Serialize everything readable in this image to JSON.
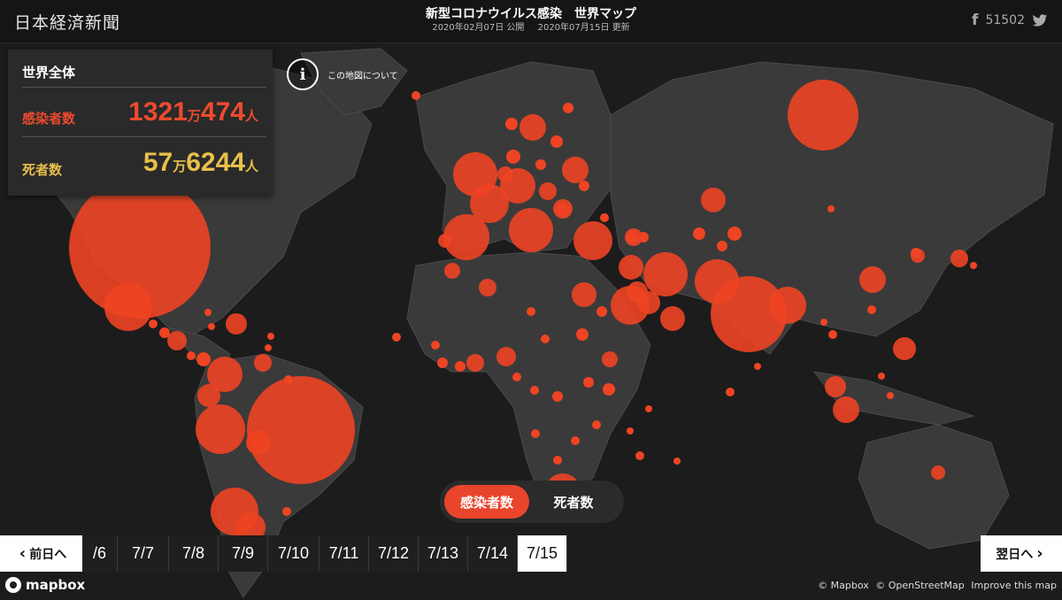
{
  "header": {
    "logo": "日本経済新聞",
    "title": "新型コロナウイルス感染　世界マップ",
    "published": "2020年02月07日 公開",
    "updated": "2020年07月15日 更新",
    "share_count": "51502",
    "icons": [
      "facebook-icon",
      "twitter-icon"
    ]
  },
  "stats": {
    "title": "世界全体",
    "cases_label": "感染者数",
    "cases": {
      "man": "1321",
      "unit_man": "万",
      "rest": "474",
      "unit": "人"
    },
    "deaths_label": "死者数",
    "deaths": {
      "man": "57",
      "unit_man": "万",
      "rest": "6244",
      "unit": "人"
    }
  },
  "about": {
    "label": "この地図について"
  },
  "toggle": {
    "cases": "感染者数",
    "deaths": "死者数",
    "selected": "cases"
  },
  "timeline": {
    "prev": "前日へ",
    "next": "翌日へ",
    "dates": [
      "/6",
      "7/7",
      "7/8",
      "7/9",
      "7/10",
      "7/11",
      "7/12",
      "7/13",
      "7/14",
      "7/15"
    ],
    "selected": "7/15"
  },
  "footer": {
    "brand": "mapbox",
    "attribution": [
      "© Mapbox",
      "© OpenStreetMap",
      "Improve this map"
    ]
  },
  "colors": {
    "bubble": "#ee4423",
    "cases": "#ee4a2f",
    "deaths": "#e8c04a",
    "land": "#3a3a3a",
    "water": "#1c1c1c"
  }
}
